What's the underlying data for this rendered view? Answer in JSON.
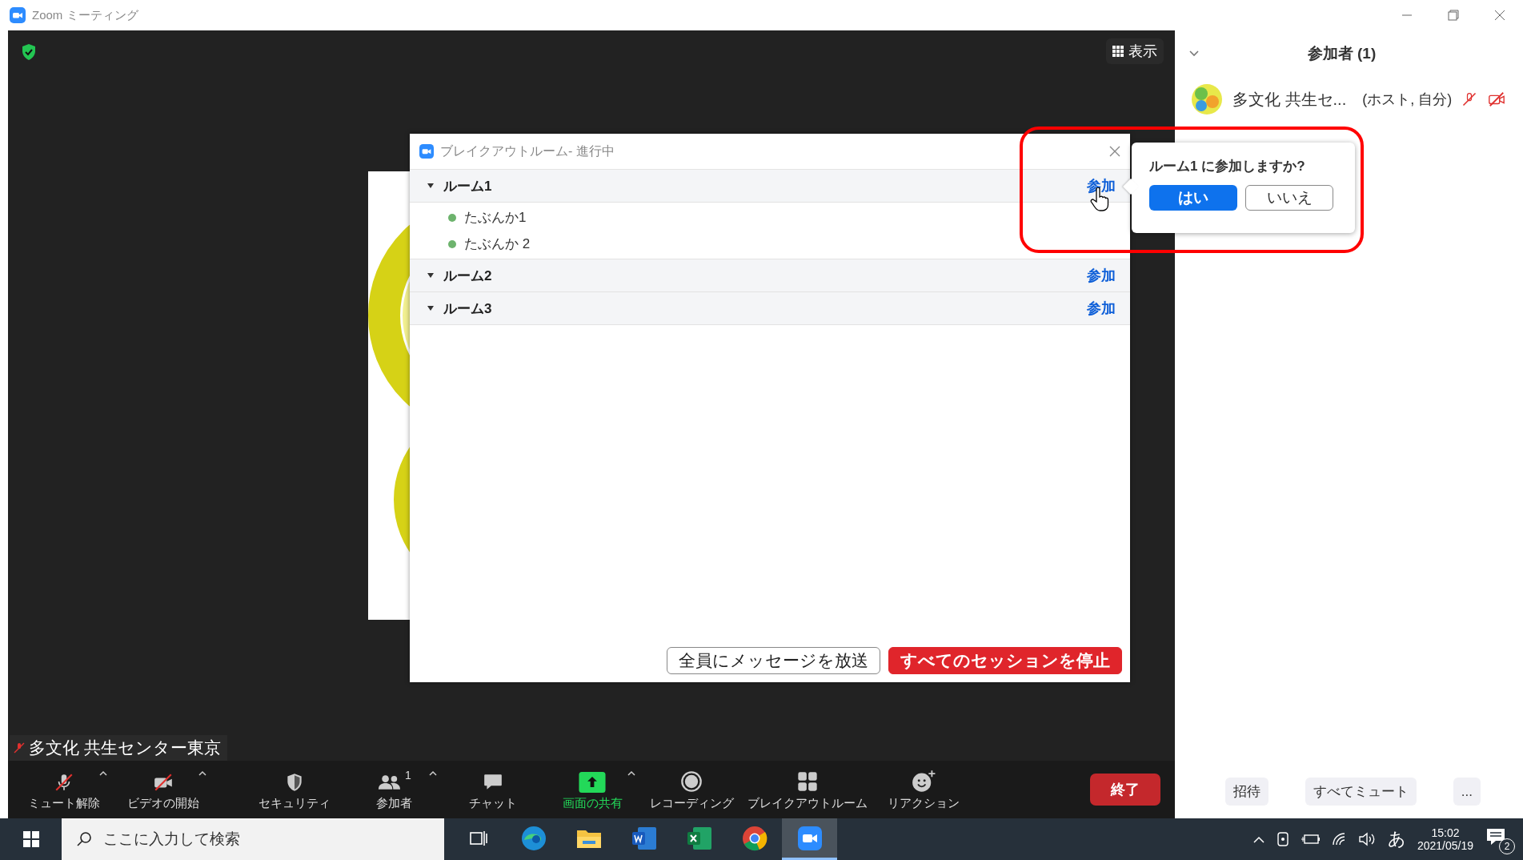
{
  "window": {
    "title": "Zoom ミーティング"
  },
  "video": {
    "view_button": "表示",
    "name_label": "多文化 共生センター東京",
    "name_muted": true
  },
  "breakout_dialog": {
    "title": "ブレイクアウトルーム- 進行中",
    "rooms": [
      {
        "name": "ルーム1",
        "join": "参加",
        "members": [
          "たぶんか1",
          "たぶんか 2"
        ]
      },
      {
        "name": "ルーム2",
        "join": "参加"
      },
      {
        "name": "ルーム3",
        "join": "参加"
      }
    ],
    "buttons": [
      {
        "label": "全員にメッセージを放送",
        "kind": "secondary"
      },
      {
        "label": "すべてのセッションを停止",
        "kind": "danger"
      }
    ]
  },
  "join_prompt": {
    "question": "ルーム1 に参加しますか?",
    "buttons": [
      {
        "label": "はい",
        "kind": "primary"
      },
      {
        "label": "いいえ",
        "kind": "secondary"
      }
    ]
  },
  "toolbar": {
    "items": [
      {
        "label": "ミュート解除",
        "kind": "mic-off",
        "caret": true
      },
      {
        "label": "ビデオの開始",
        "kind": "video-off",
        "caret": true
      },
      {
        "label": "セキュリティ",
        "kind": "security",
        "caret": false
      },
      {
        "label": "参加者",
        "kind": "participants",
        "count": "1",
        "caret": true
      },
      {
        "label": "チャット",
        "kind": "chat",
        "caret": false
      },
      {
        "label": "画面の共有",
        "kind": "share",
        "caret": true
      },
      {
        "label": "レコーディング",
        "kind": "record",
        "caret": false
      },
      {
        "label": "ブレイクアウトルーム",
        "kind": "breakout",
        "caret": false
      },
      {
        "label": "リアクション",
        "kind": "reaction",
        "caret": false
      }
    ],
    "end_button": "終了"
  },
  "participants_panel": {
    "title": "参加者 (1)",
    "participants": [
      {
        "name": "多文化 共生セ...",
        "role": "(ホスト, 自分)",
        "muted": true,
        "video_off": true
      }
    ],
    "buttons": [
      "招待",
      "すべてミュート",
      "..."
    ]
  },
  "taskbar": {
    "search_placeholder": "ここに入力して検索",
    "apps": [
      {
        "kind": "task-view",
        "selected": false
      },
      {
        "kind": "edge",
        "selected": false
      },
      {
        "kind": "explorer",
        "selected": false
      },
      {
        "kind": "word",
        "selected": false
      },
      {
        "kind": "excel",
        "selected": false
      },
      {
        "kind": "chrome",
        "selected": false
      },
      {
        "kind": "zoom",
        "selected": true
      }
    ],
    "ime": "あ",
    "time": "15:02",
    "date": "2021/05/19",
    "notifications": "2"
  }
}
